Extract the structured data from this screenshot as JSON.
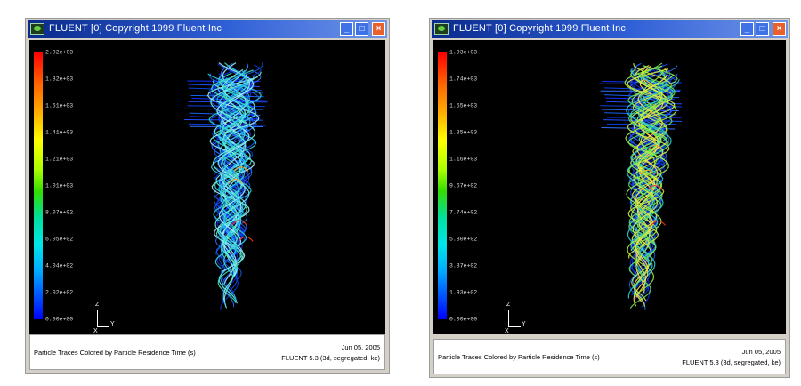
{
  "windows": [
    {
      "title": "FLUENT [0] Copyright 1999 Fluent Inc",
      "legend_ticks": [
        "2.02e+03",
        "1.82e+03",
        "1.61e+03",
        "1.41e+03",
        "1.21e+03",
        "1.01e+03",
        "8.07e+02",
        "6.05e+02",
        "4.04e+02",
        "2.02e+02",
        "0.00e+00"
      ],
      "caption": "Particle Traces Colored by Particle Residence Time (s)",
      "date": "Jun 05, 2005",
      "version": "FLUENT 5.3 (3d, segregated, ke)",
      "axes": {
        "z": "Z",
        "y": "Y",
        "x": "X"
      }
    },
    {
      "title": "FLUENT [0] Copyright 1999 Fluent Inc",
      "legend_ticks": [
        "1.93e+03",
        "1.74e+03",
        "1.55e+03",
        "1.35e+03",
        "1.16e+03",
        "9.67e+02",
        "7.74e+02",
        "5.80e+02",
        "3.87e+02",
        "1.93e+02",
        "0.00e+00"
      ],
      "caption": "Particle Traces Colored by Particle Residence Time (s)",
      "date": "Jun 05, 2005",
      "version": "FLUENT 5.3 (3d, segregated, ke)",
      "axes": {
        "z": "Z",
        "y": "Y",
        "x": "X"
      }
    }
  ]
}
